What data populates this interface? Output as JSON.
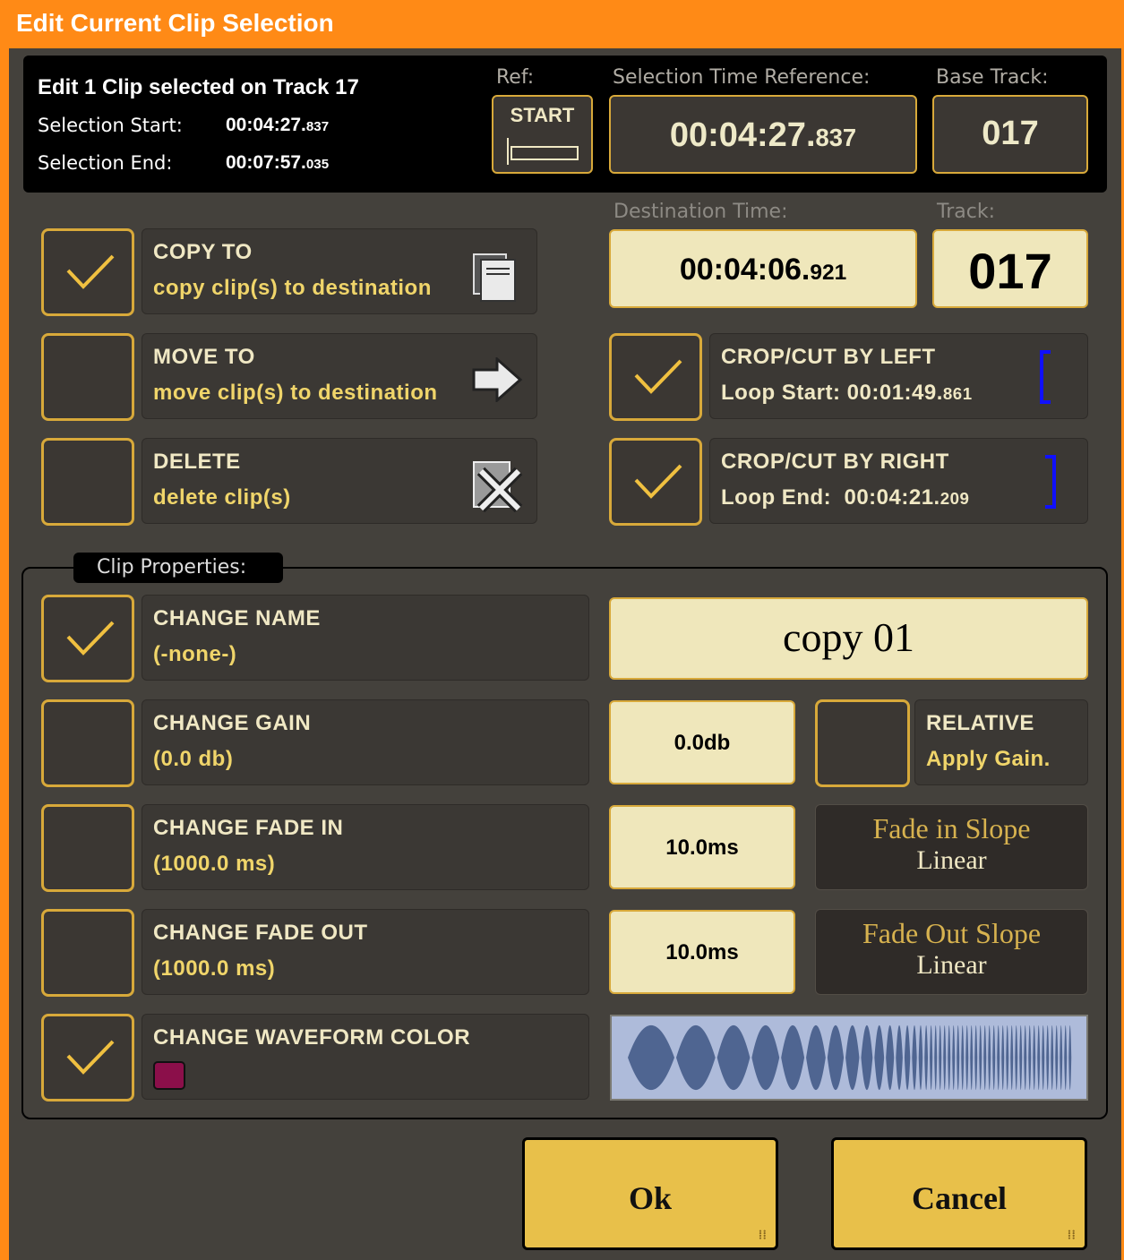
{
  "window": {
    "title": "Edit Current Clip Selection"
  },
  "header": {
    "summary": "Edit 1 Clip selected on Track 17",
    "selection_start_label": "Selection Start:",
    "selection_start_main": "00:04:27.",
    "selection_start_ms": "837",
    "selection_end_label": "Selection End:",
    "selection_end_main": "00:07:57.",
    "selection_end_ms": "035",
    "ref_label": "Ref:",
    "ref_value": "START",
    "time_ref_label": "Selection Time Reference:",
    "time_ref_main": "00:04:27.",
    "time_ref_ms": "837",
    "base_track_label": "Base Track:",
    "base_track_value": "017"
  },
  "destination": {
    "time_label": "Destination Time:",
    "time_main": "00:04:06.",
    "time_ms": "921",
    "track_label": "Track:",
    "track_value": "017"
  },
  "operations": {
    "copy": {
      "title": "COPY TO",
      "subtitle": "copy clip(s) to destination",
      "checked": true
    },
    "move": {
      "title": "MOVE TO",
      "subtitle": "move clip(s) to destination",
      "checked": false
    },
    "delete": {
      "title": "DELETE",
      "subtitle": "delete clip(s)",
      "checked": false
    },
    "crop_left": {
      "title": "CROP/CUT BY LEFT",
      "sub_label": "Loop Start: ",
      "sub_main": "00:01:49.",
      "sub_ms": "861",
      "checked": true
    },
    "crop_right": {
      "title": "CROP/CUT BY RIGHT",
      "sub_label": "Loop End:  ",
      "sub_main": "00:04:21.",
      "sub_ms": "209",
      "checked": true
    }
  },
  "clip_properties": {
    "group_label": "Clip Properties:",
    "name": {
      "title": "CHANGE NAME",
      "current": "(-none-)",
      "value": "copy 01",
      "checked": true
    },
    "gain": {
      "title": "CHANGE GAIN",
      "current": "(0.0 db)",
      "value": "0.0db",
      "checked": false,
      "relative_title": "RELATIVE",
      "relative_sub": "Apply Gain.",
      "relative_checked": false
    },
    "fade_in": {
      "title": "CHANGE FADE IN",
      "current": "(1000.0 ms)",
      "value": "10.0ms",
      "checked": false,
      "slope_title": "Fade in Slope",
      "slope_value": "Linear"
    },
    "fade_out": {
      "title": "CHANGE FADE OUT",
      "current": "(1000.0 ms)",
      "value": "10.0ms",
      "checked": false,
      "slope_title": "Fade Out Slope",
      "slope_value": "Linear"
    },
    "waveform_color": {
      "title": "CHANGE WAVEFORM COLOR",
      "checked": true,
      "swatch": "#8b0f4a",
      "wave_color": "#4f6591",
      "wave_bg": "#aebbda"
    }
  },
  "buttons": {
    "ok": "Ok",
    "cancel": "Cancel"
  },
  "colors": {
    "accent": "#ff8a16",
    "border_gold": "#d8a93a",
    "cream": "#efe7bb",
    "button": "#e8c04a",
    "bracket": "#1010ff"
  }
}
